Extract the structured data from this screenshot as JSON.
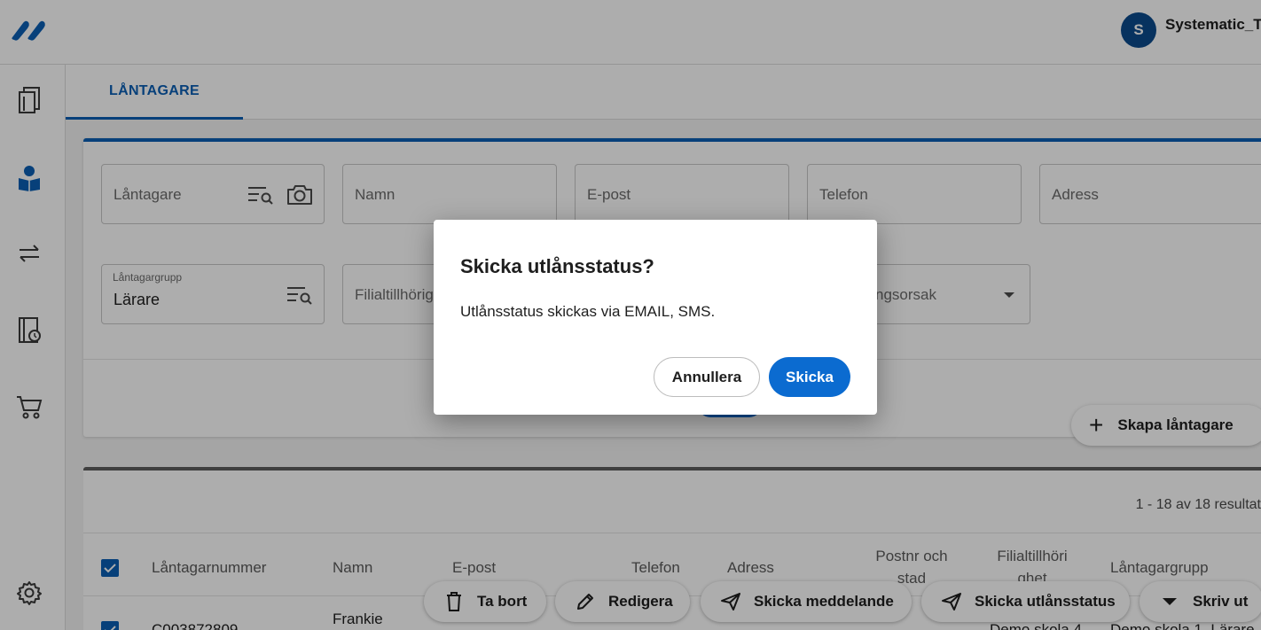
{
  "header": {
    "avatar_initial": "S",
    "user_name": "Systematic_T"
  },
  "rail": {
    "items": [
      "catalog-icon",
      "borrower-icon",
      "loans-swap-icon",
      "history-icon",
      "cart-icon"
    ],
    "settings_icon": "gear-icon"
  },
  "tabs": [
    {
      "label": "LÅNTAGARE",
      "active": true
    }
  ],
  "search": {
    "borrower_placeholder": "Låntagare",
    "name_placeholder": "Namn",
    "email_placeholder": "E-post",
    "phone_placeholder": "Telefon",
    "address_placeholder": "Adress",
    "group_label": "Låntagargrupp",
    "group_value": "Lärare",
    "branch_placeholder": "Filialtillhörig",
    "reason_placeholder": "ngsorsak"
  },
  "create_button_label": "Skapa låntagare",
  "results": {
    "count_text": "1 - 18 av 18 resultat",
    "columns": {
      "number": "Låntagarnummer",
      "name": "Namn",
      "email": "E-post",
      "phone": "Telefon",
      "address": "Adress",
      "postal_l1": "Postnr och",
      "postal_l2": "stad",
      "branch_l1": "Filialtillhöri",
      "branch_l2": "ghet",
      "group": "Låntagargrupp"
    },
    "row1": {
      "number": "C003872809",
      "name": "Frankie",
      "branch": "Demo skola 4",
      "group": "Demo skola 1, Lärare"
    }
  },
  "actions": {
    "delete": "Ta bort",
    "edit": "Redigera",
    "send_message": "Skicka meddelande",
    "send_status": "Skicka utlånsstatus",
    "print": "Skriv ut"
  },
  "dialog": {
    "title": "Skicka utlånsstatus?",
    "message": "Utlånsstatus skickas via EMAIL, SMS.",
    "cancel_label": "Annullera",
    "confirm_label": "Skicka"
  },
  "colors": {
    "primary": "#0b6bd0",
    "tab_accent": "#0b5fb4",
    "avatar_bg": "#0b4a8c"
  }
}
